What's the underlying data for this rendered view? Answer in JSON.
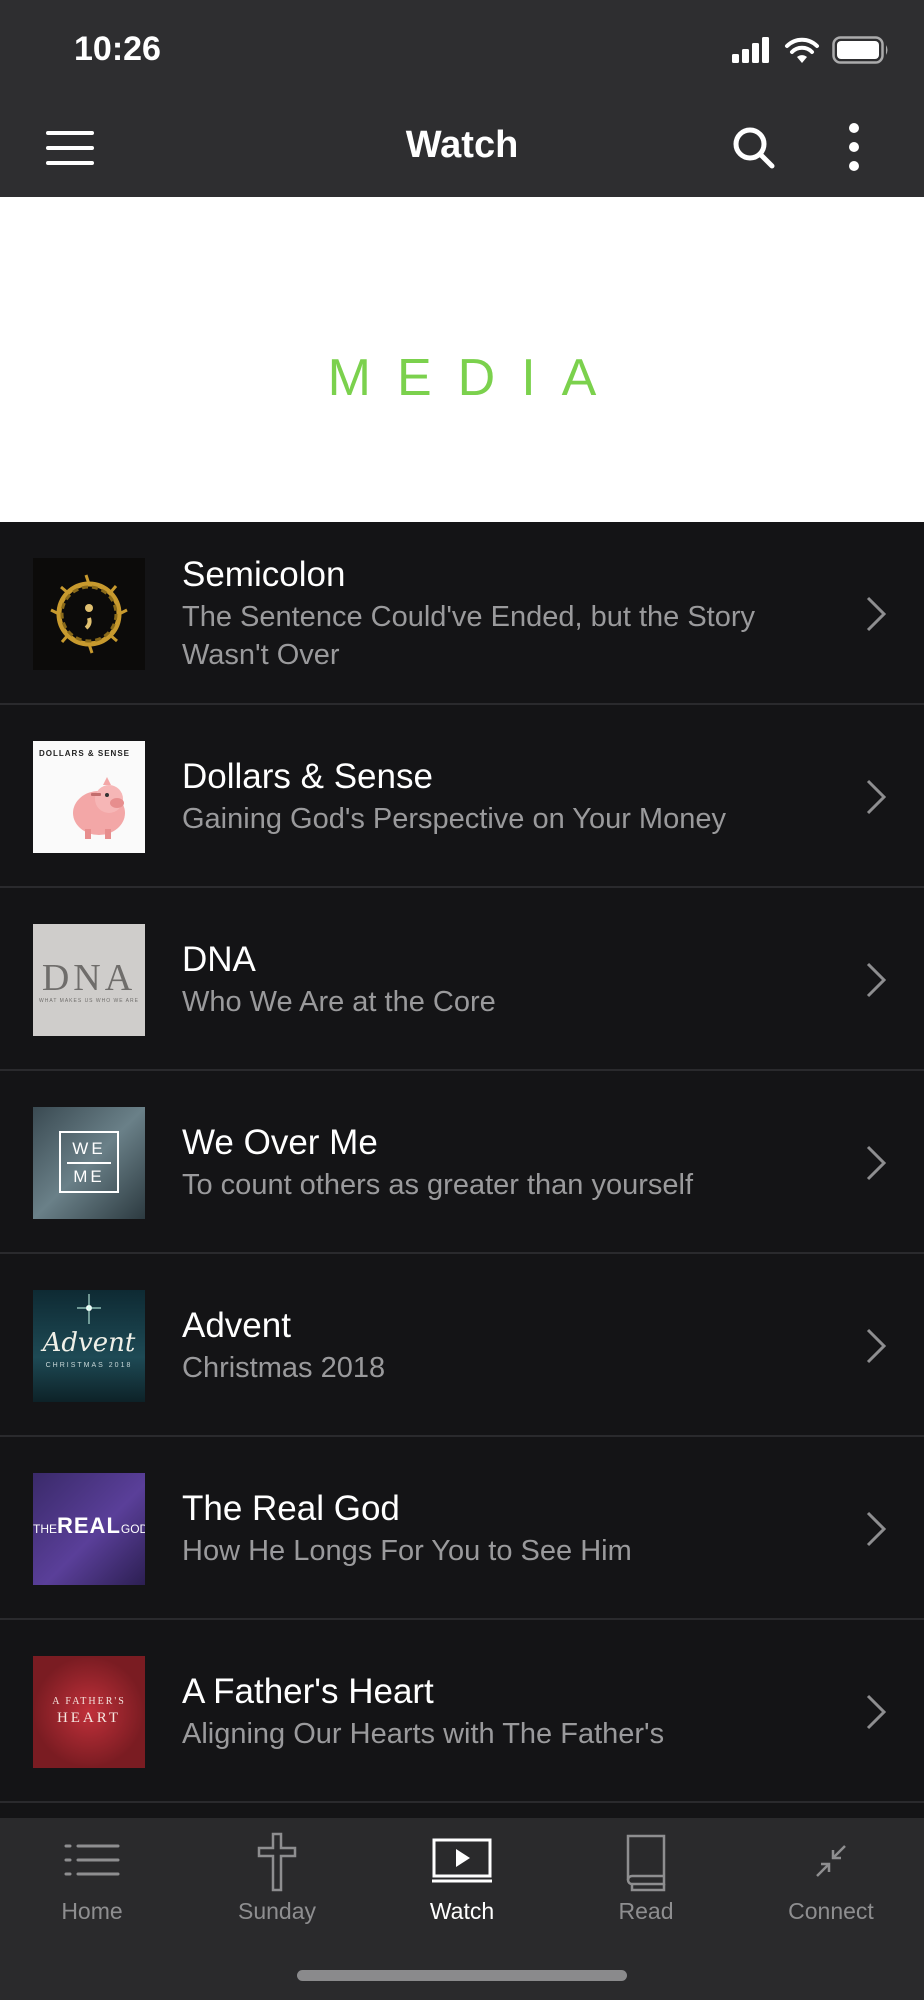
{
  "status": {
    "time": "10:26"
  },
  "nav": {
    "title": "Watch",
    "menu_icon": "hamburger-menu-icon",
    "search_icon": "search-icon",
    "more_icon": "more-vertical-icon"
  },
  "banner": {
    "text": "MEDIA",
    "color": "#7bd14d"
  },
  "series": [
    {
      "title": "Semicolon",
      "subtitle": "The Sentence Could've Ended, but the Story Wasn't Over",
      "thumb": "crown-of-thorns"
    },
    {
      "title": "Dollars & Sense",
      "subtitle": "Gaining God's Perspective on Your Money",
      "thumb": "piggy-bank",
      "thumb_text": "DOLLARS & SENSE"
    },
    {
      "title": "DNA",
      "subtitle": "Who We Are at the Core",
      "thumb": "dna",
      "thumb_text": "DNA",
      "thumb_caption": "WHAT MAKES US WHO WE ARE"
    },
    {
      "title": "We Over Me",
      "subtitle": "To count others as greater than yourself",
      "thumb": "we-over-me",
      "thumb_top": "WE",
      "thumb_bottom": "ME"
    },
    {
      "title": "Advent",
      "subtitle": "Christmas 2018",
      "thumb": "advent",
      "thumb_text": "Advent",
      "thumb_caption": "CHRISTMAS 2018"
    },
    {
      "title": "The Real God",
      "subtitle": "How He Longs For You to See Him",
      "thumb": "real-god",
      "thumb_prefix": "THE",
      "thumb_main": "REAL",
      "thumb_suffix": "GOD"
    },
    {
      "title": "A Father's Heart",
      "subtitle": "Aligning Our Hearts with The Father's",
      "thumb": "fathers-heart",
      "thumb_top": "A FATHER'S",
      "thumb_bottom": "HEART"
    }
  ],
  "tabs": [
    {
      "label": "Home",
      "icon": "list-icon",
      "active": false
    },
    {
      "label": "Sunday",
      "icon": "cross-icon",
      "active": false
    },
    {
      "label": "Watch",
      "icon": "play-screen-icon",
      "active": true
    },
    {
      "label": "Read",
      "icon": "book-icon",
      "active": false
    },
    {
      "label": "Connect",
      "icon": "connect-arrows-icon",
      "active": false
    }
  ]
}
